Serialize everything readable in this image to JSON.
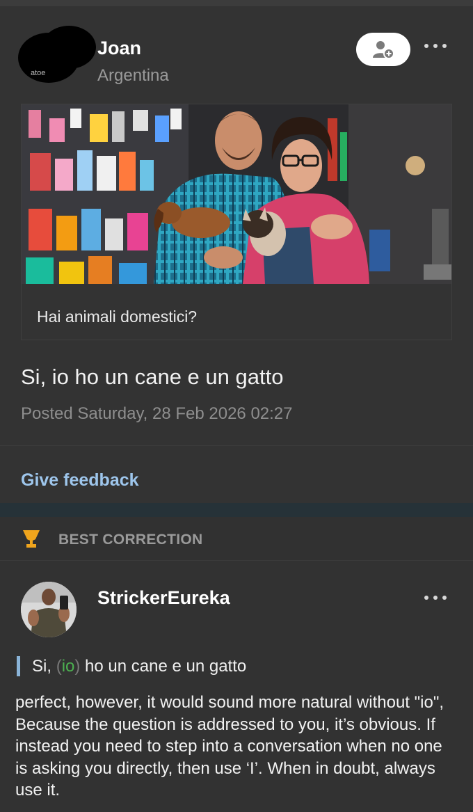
{
  "post": {
    "author": {
      "name": "Joan",
      "country": "Argentina",
      "avatar_peek_text": "atoe"
    },
    "follow_icon": "add-user-icon",
    "more_icon": "more-dots-icon",
    "prompt": {
      "text": "Hai animali domestici?"
    },
    "text": "Si, io ho un cane e un gatto",
    "posted": "Posted Saturday, 28 Feb 2026 02:27",
    "feedback_label": "Give feedback"
  },
  "best_correction": {
    "label": "BEST CORRECTION",
    "icon": "trophy-icon",
    "color": "#f0a51d"
  },
  "correction": {
    "author": "StrickerEureka",
    "more_icon": "more-dots-icon",
    "line": {
      "before": "Si, ",
      "open": "(",
      "removed": "io",
      "close": ")",
      "after": " ho un cane e un gatto"
    },
    "comment": "perfect, however, it would sound more natural without \"io\", Because the question is addressed to you, it’s obvious. If instead you need to step into a conversation when no one is asking you directly, then use ‘I’. When in doubt, always use it."
  },
  "colors": {
    "background": "#2f2f2f",
    "link": "#9ec6ec",
    "removed_word": "#4caf50",
    "highlight_bar": "#8ab4d8"
  }
}
